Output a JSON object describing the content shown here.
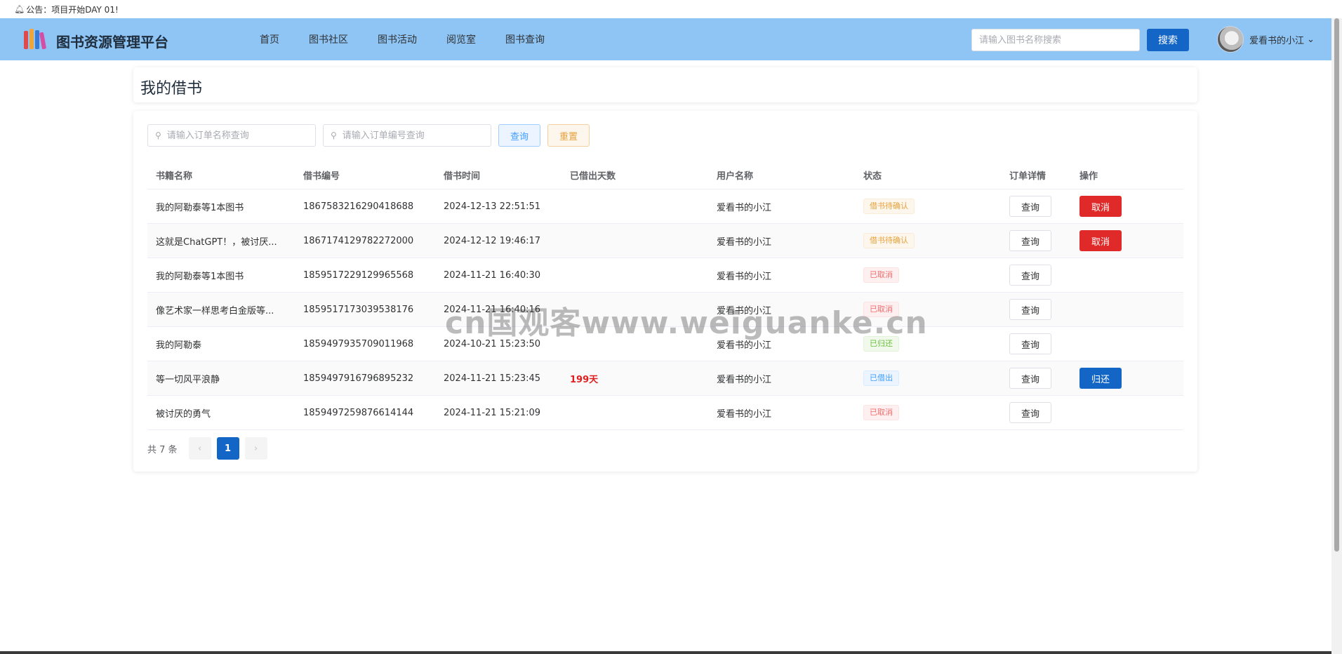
{
  "notice": {
    "icon": "bell-icon",
    "text": "公告：项目开始DAY 01!"
  },
  "header": {
    "brand": "图书资源管理平台",
    "nav": [
      "首页",
      "图书社区",
      "图书活动",
      "阅览室",
      "图书查询"
    ],
    "search_placeholder": "请输入图书名称搜索",
    "search_button": "搜索",
    "user_name": "爱看书的小江"
  },
  "page": {
    "title": "我的借书"
  },
  "filters": {
    "name_placeholder": "请输入订单名称查询",
    "number_placeholder": "请输入订单编号查询",
    "query_button": "查询",
    "reset_button": "重置"
  },
  "table": {
    "columns": [
      "书籍名称",
      "借书编号",
      "借书时间",
      "已借出天数",
      "用户名称",
      "状态",
      "订单详情",
      "操作"
    ],
    "detail_button": "查询",
    "cancel_button": "取消",
    "return_button": "归还",
    "rows": [
      {
        "name": "我的阿勒泰等1本图书",
        "number": "1867583216290418688",
        "time": "2024-12-13 22:51:51",
        "days": "",
        "user": "爱看书的小江",
        "status": "借书待确认",
        "status_type": "warning",
        "action": "cancel"
      },
      {
        "name": "这就是ChatGPT！，被讨厌...",
        "number": "1867174129782272000",
        "time": "2024-12-12 19:46:17",
        "days": "",
        "user": "爱看书的小江",
        "status": "借书待确认",
        "status_type": "warning",
        "action": "cancel"
      },
      {
        "name": "我的阿勒泰等1本图书",
        "number": "1859517229129965568",
        "time": "2024-11-21 16:40:30",
        "days": "",
        "user": "爱看书的小江",
        "status": "已取消",
        "status_type": "danger",
        "action": ""
      },
      {
        "name": "像艺术家一样思考白金版等...",
        "number": "1859517173039538176",
        "time": "2024-11-21 16:40:16",
        "days": "",
        "user": "爱看书的小江",
        "status": "已取消",
        "status_type": "danger",
        "action": ""
      },
      {
        "name": "我的阿勒泰",
        "number": "1859497935709011968",
        "time": "2024-10-21 15:23:50",
        "days": "",
        "user": "爱看书的小江",
        "status": "已归还",
        "status_type": "success",
        "action": ""
      },
      {
        "name": "等一切风平浪静",
        "number": "1859497916796895232",
        "time": "2024-11-21 15:23:45",
        "days": "199天",
        "user": "爱看书的小江",
        "status": "已借出",
        "status_type": "primary",
        "action": "return"
      },
      {
        "name": "被讨厌的勇气",
        "number": "1859497259876614144",
        "time": "2024-11-21 15:21:09",
        "days": "",
        "user": "爱看书的小江",
        "status": "已取消",
        "status_type": "danger",
        "action": ""
      }
    ]
  },
  "pagination": {
    "total": "共 7 条",
    "current": "1",
    "prev": "‹",
    "next": "›"
  },
  "watermark": "cn国观客www.weiguanke.cn",
  "colors": {
    "header_bg": "#8ec5f5",
    "primary": "#1366c5",
    "danger": "#e02a2a"
  }
}
